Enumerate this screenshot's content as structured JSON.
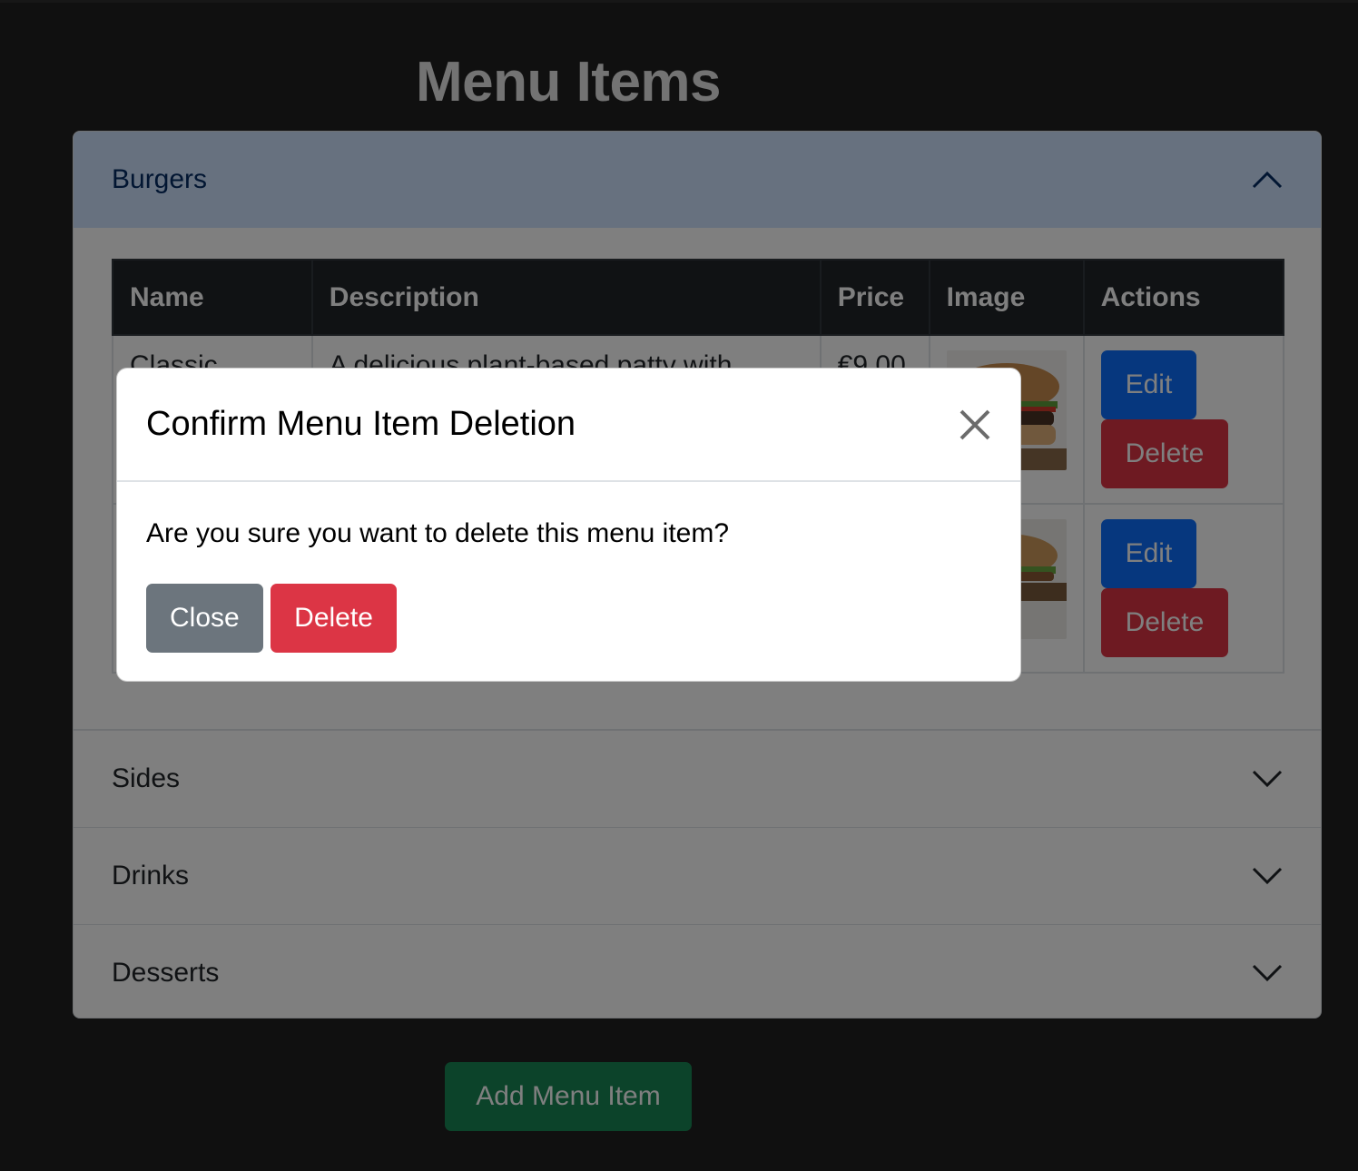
{
  "page": {
    "title": "Menu Items"
  },
  "accordion": {
    "sections": [
      {
        "label": "Burgers",
        "expanded": true
      },
      {
        "label": "Sides",
        "expanded": false
      },
      {
        "label": "Drinks",
        "expanded": false
      },
      {
        "label": "Desserts",
        "expanded": false
      }
    ]
  },
  "table": {
    "headers": [
      "Name",
      "Description",
      "Price",
      "Image",
      "Actions"
    ],
    "rows": [
      {
        "name": "Classic",
        "description": "A delicious plant-based patty with",
        "price": "€9.00"
      },
      {
        "name": "",
        "description": "",
        "price": ""
      }
    ],
    "edit_label": "Edit",
    "delete_label": "Delete"
  },
  "add_button": {
    "label": "Add Menu Item"
  },
  "modal": {
    "title": "Confirm Menu Item Deletion",
    "message": "Are you sure you want to delete this menu item?",
    "close_label": "Close",
    "delete_label": "Delete"
  },
  "colors": {
    "primary": "#0d6efd",
    "danger": "#dc3545",
    "secondary": "#6c757d",
    "success": "#198754",
    "accordion_active": "#cfe2ff"
  },
  "icons": [
    "chevron-up-icon",
    "chevron-down-icon",
    "close-icon"
  ]
}
